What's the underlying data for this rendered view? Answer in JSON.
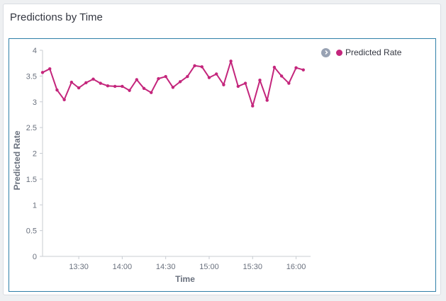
{
  "panel": {
    "title": "Predictions by Time"
  },
  "legend": {
    "toggle_icon": "chevron-right-icon",
    "label": "Predicted Rate"
  },
  "colors": {
    "series": "#c4267c",
    "axis": "#69707d",
    "grid": "#e4e6ea",
    "frame": "#2f7fa8"
  },
  "chart_data": {
    "type": "line",
    "title": "",
    "xlabel": "Time",
    "ylabel": "Predicted Rate",
    "ylim": [
      0,
      4
    ],
    "yticks": [
      0,
      0.5,
      1,
      1.5,
      2,
      2.5,
      3,
      3.5,
      4
    ],
    "yticklabels": [
      "0",
      "0.5",
      "1",
      "1.5",
      "2",
      "2.5",
      "3",
      "3.5",
      "4"
    ],
    "xlim": [
      "13:05",
      "16:10"
    ],
    "xticks": [
      "13:30",
      "14:00",
      "14:30",
      "15:00",
      "15:30",
      "16:00"
    ],
    "grid": false,
    "legend_position": "top-right",
    "series": [
      {
        "name": "Predicted Rate",
        "x": [
          "13:05",
          "13:10",
          "13:15",
          "13:20",
          "13:25",
          "13:30",
          "13:35",
          "13:40",
          "13:45",
          "13:50",
          "13:55",
          "14:00",
          "14:05",
          "14:10",
          "14:15",
          "14:20",
          "14:25",
          "14:30",
          "14:35",
          "14:40",
          "14:45",
          "14:50",
          "14:55",
          "15:00",
          "15:05",
          "15:10",
          "15:15",
          "15:20",
          "15:25",
          "15:30",
          "15:35",
          "15:40",
          "15:45",
          "15:50",
          "15:55",
          "16:00",
          "16:05"
        ],
        "values": [
          3.57,
          3.64,
          3.23,
          3.04,
          3.38,
          3.27,
          3.37,
          3.44,
          3.36,
          3.31,
          3.3,
          3.3,
          3.22,
          3.43,
          3.26,
          3.18,
          3.45,
          3.49,
          3.28,
          3.39,
          3.49,
          3.7,
          3.68,
          3.47,
          3.54,
          3.33,
          3.79,
          3.3,
          3.36,
          2.92,
          3.42,
          3.03,
          3.67,
          3.5,
          3.36,
          3.66,
          3.62
        ]
      }
    ]
  }
}
